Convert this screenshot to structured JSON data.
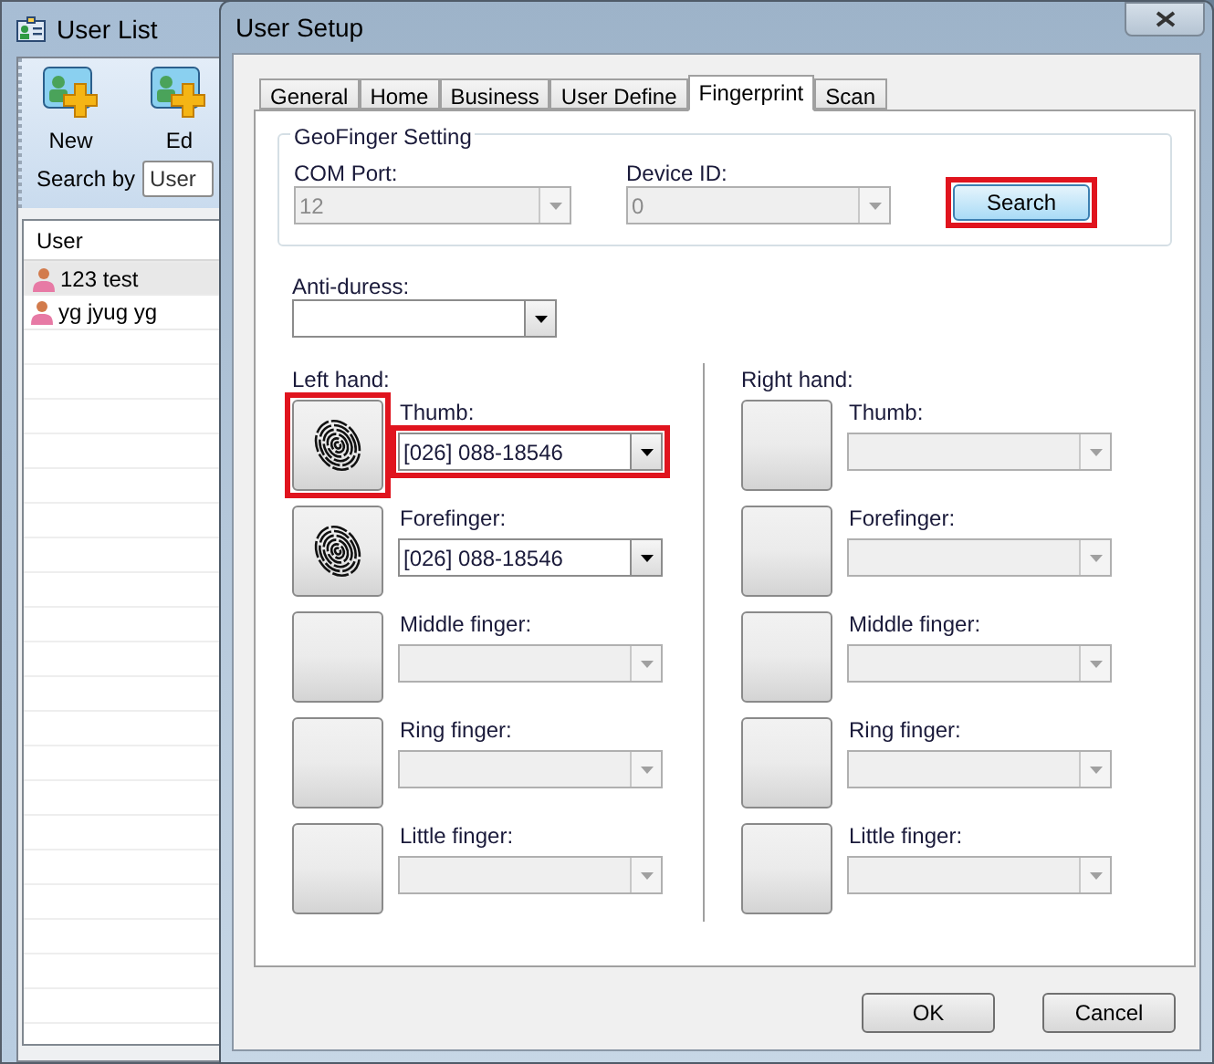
{
  "background_window": {
    "title": "User List",
    "toolbar": [
      {
        "label": "New"
      },
      {
        "label": "Ed"
      }
    ],
    "search_by": {
      "label": "Search by",
      "value": "User"
    },
    "list": {
      "header": "User",
      "rows": [
        {
          "name": "123 test",
          "selected": true
        },
        {
          "name": "yg jyug yg",
          "selected": false
        }
      ]
    }
  },
  "dialog": {
    "title": "User Setup",
    "tabs": [
      {
        "label": "General",
        "selected": false
      },
      {
        "label": "Home",
        "selected": false
      },
      {
        "label": "Business",
        "selected": false
      },
      {
        "label": "User Define",
        "selected": false
      },
      {
        "label": "Fingerprint",
        "selected": true
      },
      {
        "label": "Scan",
        "selected": false
      }
    ],
    "group": {
      "title": "GeoFinger Setting",
      "com_port": {
        "label": "COM Port:",
        "value": "12",
        "disabled": true
      },
      "device_id": {
        "label": "Device ID:",
        "value": "0",
        "disabled": true
      },
      "search_button": {
        "label": "Search",
        "highlighted": true
      }
    },
    "anti_duress": {
      "label": "Anti-duress:",
      "disabled": false
    },
    "hands": [
      {
        "label": "Left hand:",
        "fingers": [
          {
            "label": "Thumb:",
            "value": "[026] 088-18546",
            "enrolled": true,
            "disabled": false,
            "highlighted": true
          },
          {
            "label": "Forefinger:",
            "value": "[026] 088-18546",
            "enrolled": true,
            "disabled": false,
            "highlighted": false
          },
          {
            "label": "Middle finger:",
            "enrolled": false,
            "disabled": true,
            "highlighted": false
          },
          {
            "label": "Ring finger:",
            "enrolled": false,
            "disabled": true,
            "highlighted": false
          },
          {
            "label": "Little finger:",
            "enrolled": false,
            "disabled": true,
            "highlighted": false
          }
        ]
      },
      {
        "label": "Right hand:",
        "fingers": [
          {
            "label": "Thumb:",
            "enrolled": false,
            "disabled": true,
            "highlighted": false
          },
          {
            "label": "Forefinger:",
            "enrolled": false,
            "disabled": true,
            "highlighted": false
          },
          {
            "label": "Middle finger:",
            "enrolled": false,
            "disabled": true,
            "highlighted": false
          },
          {
            "label": "Ring finger:",
            "enrolled": false,
            "disabled": true,
            "highlighted": false
          },
          {
            "label": "Little finger:",
            "enrolled": false,
            "disabled": true,
            "highlighted": false
          }
        ]
      }
    ],
    "buttons": [
      "OK",
      "Cancel"
    ]
  }
}
